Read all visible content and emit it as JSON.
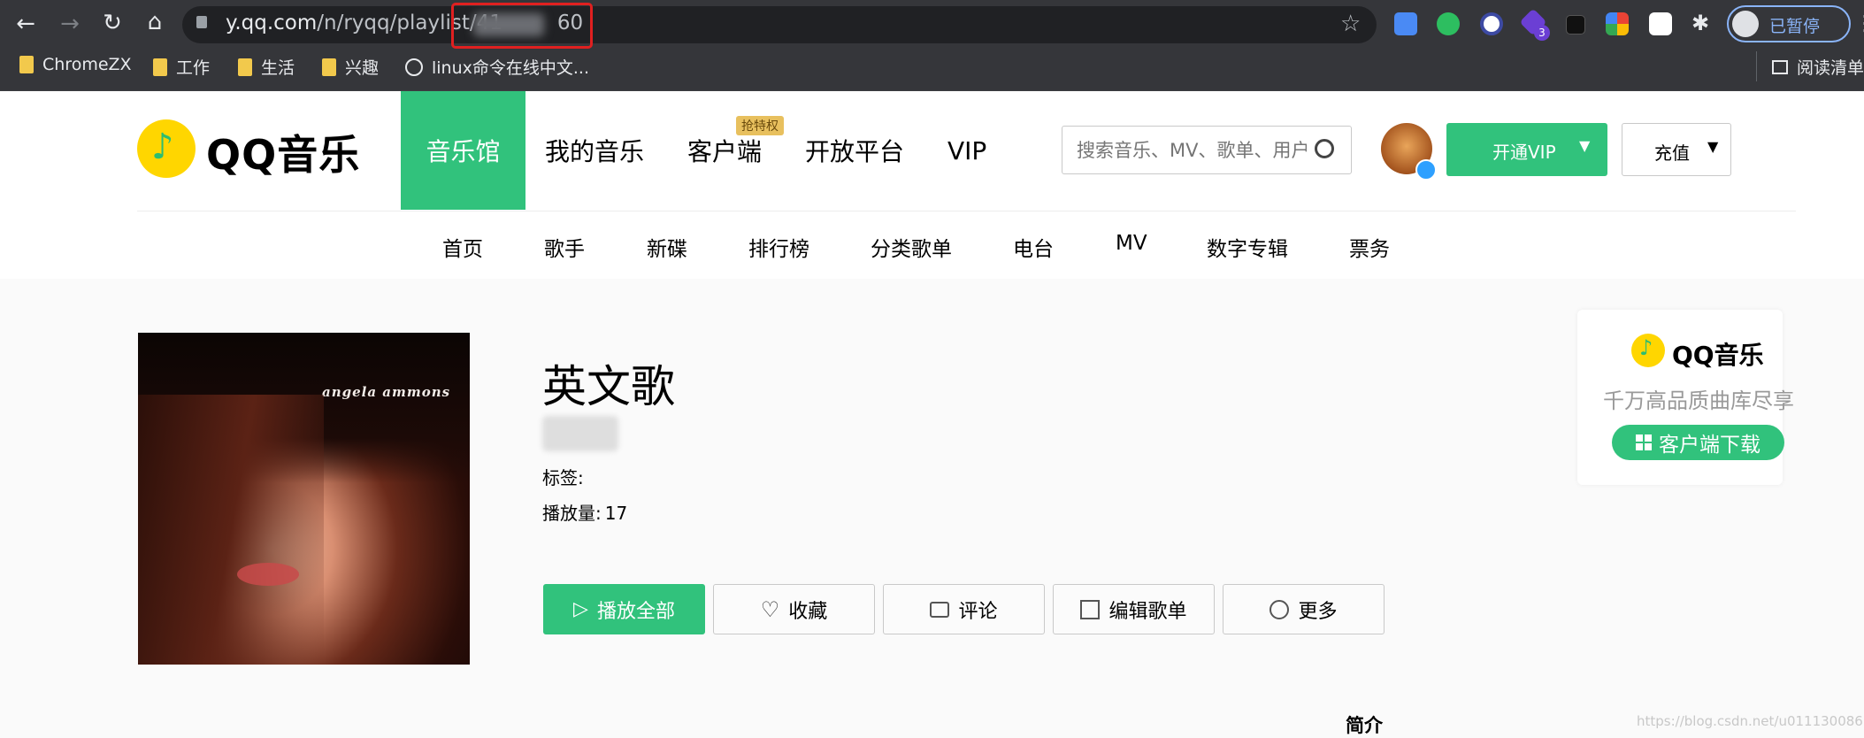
{
  "browser": {
    "url_host": "y.qq.com",
    "url_path": "/n/ryqq/playlist/41",
    "url_end": "60",
    "profile_label": "已暂停",
    "extension_badge": "3",
    "bookmarks": [
      "ChromeZX",
      "工作",
      "生活",
      "兴趣",
      "linux命令在线中文..."
    ],
    "reading_list": "阅读清单"
  },
  "header": {
    "logo_text": "QQ音乐",
    "tabs": [
      "音乐馆",
      "我的音乐",
      "客户端",
      "开放平台",
      "VIP"
    ],
    "tab_badge": "抢特权",
    "search_placeholder": "搜索音乐、MV、歌单、用户",
    "vip_button": "开通VIP",
    "charge_button": "充值",
    "subnav": [
      "首页",
      "歌手",
      "新碟",
      "排行榜",
      "分类歌单",
      "电台",
      "MV",
      "数字专辑",
      "票务"
    ]
  },
  "playlist": {
    "cover_text": "angela ammons",
    "title": "英文歌",
    "tags_label": "标签:",
    "plays_label": "播放量:",
    "plays_value": "17",
    "actions": [
      "播放全部",
      "收藏",
      "评论",
      "编辑歌单",
      "更多"
    ],
    "intro_label": "简介"
  },
  "promo": {
    "logo_text": "QQ音乐",
    "slogan": "千万高品质曲库尽享",
    "download": "客户端下载"
  },
  "watermark": "https://blog.csdn.net/u011130086",
  "colors": {
    "brand_green": "#31c27c",
    "chrome_bg": "#35363a",
    "highlight_red": "#e02020"
  }
}
